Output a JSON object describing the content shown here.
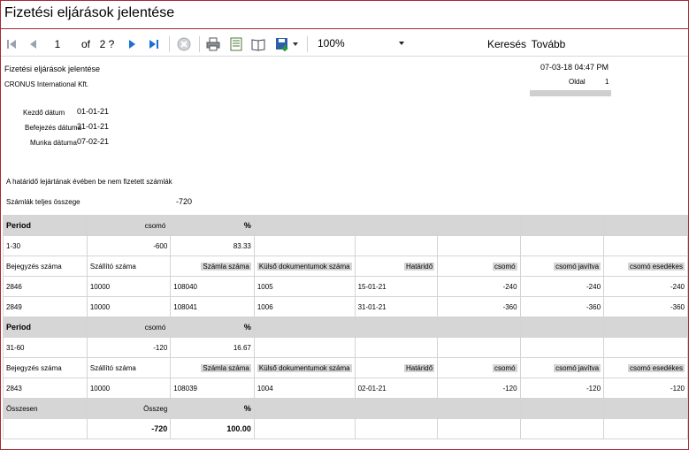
{
  "window": {
    "title": "Fizetési eljárások jelentése"
  },
  "toolbar": {
    "page_value": "1",
    "of_label": "of",
    "page_count": "2 ?",
    "zoom_value": "100%",
    "find_label": "Keresés",
    "next_label": "Tovább"
  },
  "report": {
    "title": "Fizetési eljárások jelentése",
    "company": "CRONUS International Kft.",
    "datetime": "07-03-18 04:47 PM",
    "page_label": "Oldal",
    "page_no": "1",
    "fields": [
      {
        "label": "Kezdő dátum",
        "value": "01-01-21"
      },
      {
        "label": "Befejezés dátuma",
        "value": "31-01-21"
      },
      {
        "label": "Munka dátuma",
        "value": "07-02-21"
      }
    ],
    "description": "A határidő lejártának évében be nem fizetett számlák",
    "total_label": "Számlák teljes összege",
    "total_value": "-720"
  },
  "table": {
    "group_header": {
      "period": "Period",
      "amount": "csomó",
      "percent": "%"
    },
    "detail_header": {
      "doc_no": "Bejegyzés száma",
      "vendor_no": "Szállító száma",
      "invoice_no": "Számla száma",
      "ext_doc_no": "Külső dokumentumok száma",
      "due_date": "Határidő",
      "amount": "csomó",
      "amount_adj": "csomó javítva",
      "amount_due": "csomó esedékes"
    },
    "groups": [
      {
        "period": "1-30",
        "amount": "-600",
        "percent": "83.33",
        "rows": [
          {
            "doc_no": "2846",
            "vendor_no": "10000",
            "invoice_no": "108040",
            "ext_doc_no": "1005",
            "due_date": "15-01-21",
            "amount": "-240",
            "amount_adj": "-240",
            "amount_due": "-240"
          },
          {
            "doc_no": "2849",
            "vendor_no": "10000",
            "invoice_no": "108041",
            "ext_doc_no": "1006",
            "due_date": "31-01-21",
            "amount": "-360",
            "amount_adj": "-360",
            "amount_due": "-360"
          }
        ]
      },
      {
        "period": "31-60",
        "amount": "-120",
        "percent": "16.67",
        "rows": [
          {
            "doc_no": "2843",
            "vendor_no": "10000",
            "invoice_no": "108039",
            "ext_doc_no": "1004",
            "due_date": "02-01-21",
            "amount": "-120",
            "amount_adj": "-120",
            "amount_due": "-120"
          }
        ]
      }
    ],
    "totals": {
      "label": "Összesen",
      "amount_label": "Összeg",
      "percent_label": "%",
      "amount": "-720",
      "percent": "100.00"
    }
  }
}
